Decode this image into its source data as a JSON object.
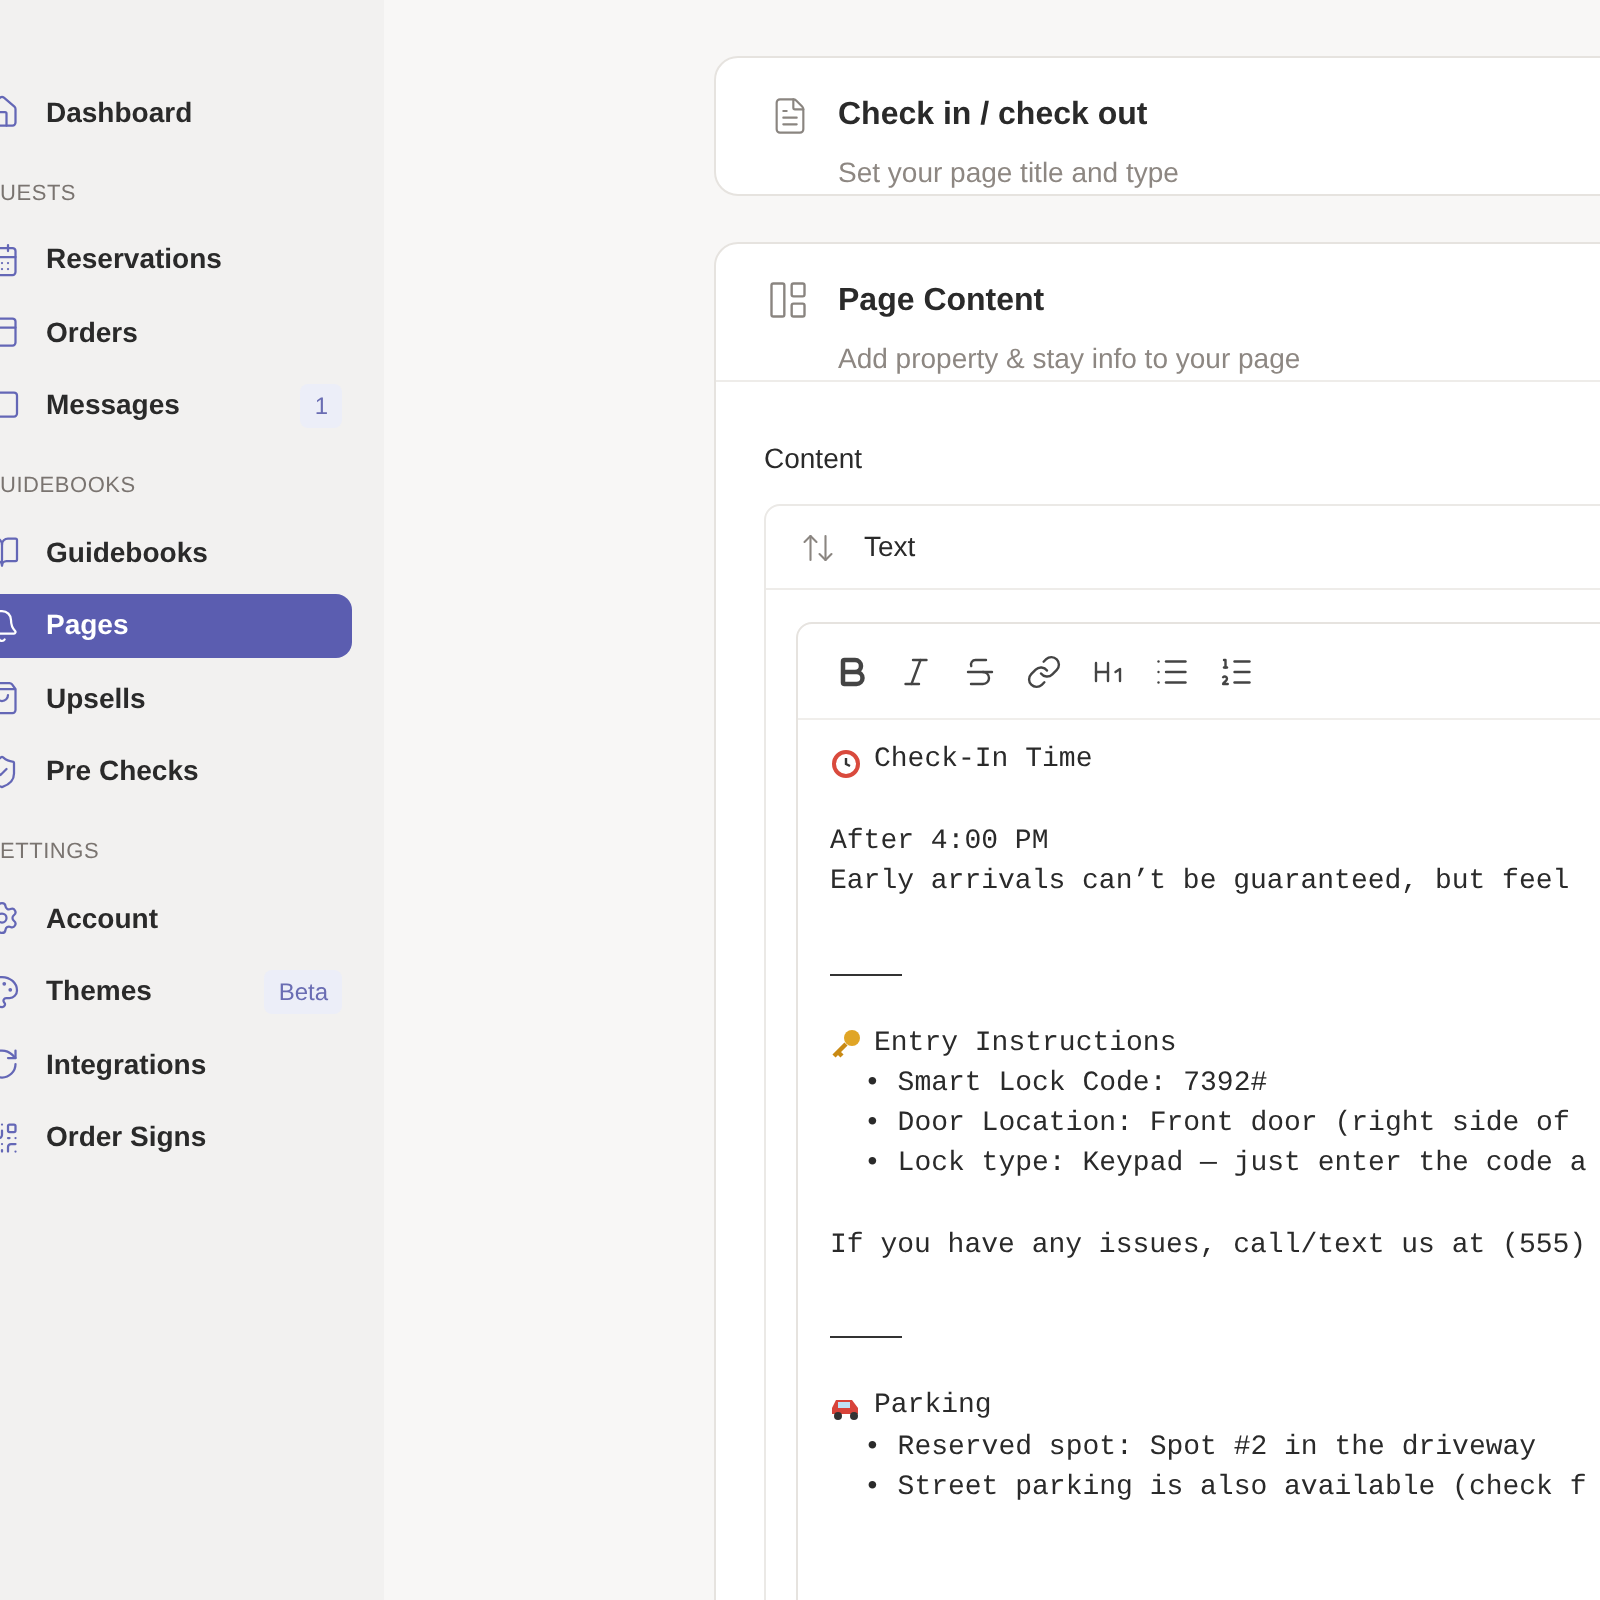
{
  "sidebar": {
    "items": [
      {
        "kind": "item",
        "label": "Dashboard",
        "selected": false
      },
      {
        "kind": "section",
        "label": "UESTS"
      },
      {
        "kind": "item",
        "label": "Reservations",
        "selected": false
      },
      {
        "kind": "item",
        "label": "Orders",
        "selected": false
      },
      {
        "kind": "item",
        "label": "Messages",
        "selected": false,
        "badge": "1"
      },
      {
        "kind": "section",
        "label": "UIDEBOOKS"
      },
      {
        "kind": "item",
        "label": "Guidebooks",
        "selected": false
      },
      {
        "kind": "item",
        "label": "Pages",
        "selected": true
      },
      {
        "kind": "item",
        "label": "Upsells",
        "selected": false
      },
      {
        "kind": "item",
        "label": "Pre Checks",
        "selected": false
      },
      {
        "kind": "section",
        "label": "ETTINGS"
      },
      {
        "kind": "item",
        "label": "Account",
        "selected": false
      },
      {
        "kind": "item",
        "label": "Themes",
        "selected": false,
        "badge": "Beta"
      },
      {
        "kind": "item",
        "label": "Integrations",
        "selected": false
      },
      {
        "kind": "item",
        "label": "Order Signs",
        "selected": false
      }
    ]
  },
  "title_card": {
    "title": "Check in / check out",
    "subtitle": "Set your page title and type"
  },
  "content_card": {
    "title": "Page Content",
    "subtitle": "Add property & stay info to your page",
    "field_label": "Content",
    "block_type": "Text",
    "editor_lines": [
      {
        "kind": "heading",
        "text": "Check-In Time"
      },
      {
        "kind": "blank"
      },
      {
        "kind": "text",
        "text": "After 4:00 PM"
      },
      {
        "kind": "text",
        "text": "Early arrivals can’t be guaranteed, but feel"
      },
      {
        "kind": "blank"
      },
      {
        "kind": "rule"
      },
      {
        "kind": "blank"
      },
      {
        "kind": "heading",
        "text": "Entry Instructions"
      },
      {
        "kind": "bullet",
        "text": "• Smart Lock Code: 7392#"
      },
      {
        "kind": "bullet",
        "text": "• Door Location: Front door (right side of"
      },
      {
        "kind": "bullet",
        "text": "• Lock type: Keypad — just enter the code a"
      },
      {
        "kind": "blank"
      },
      {
        "kind": "text",
        "text": "If you have any issues, call/text us at (555)"
      },
      {
        "kind": "blank"
      },
      {
        "kind": "rule"
      },
      {
        "kind": "blank"
      },
      {
        "kind": "heading",
        "text": "Parking"
      },
      {
        "kind": "bullet",
        "text": "• Reserved spot: Spot #2 in the driveway"
      },
      {
        "kind": "bullet",
        "text": "• Street parking is also available (check f"
      }
    ]
  }
}
